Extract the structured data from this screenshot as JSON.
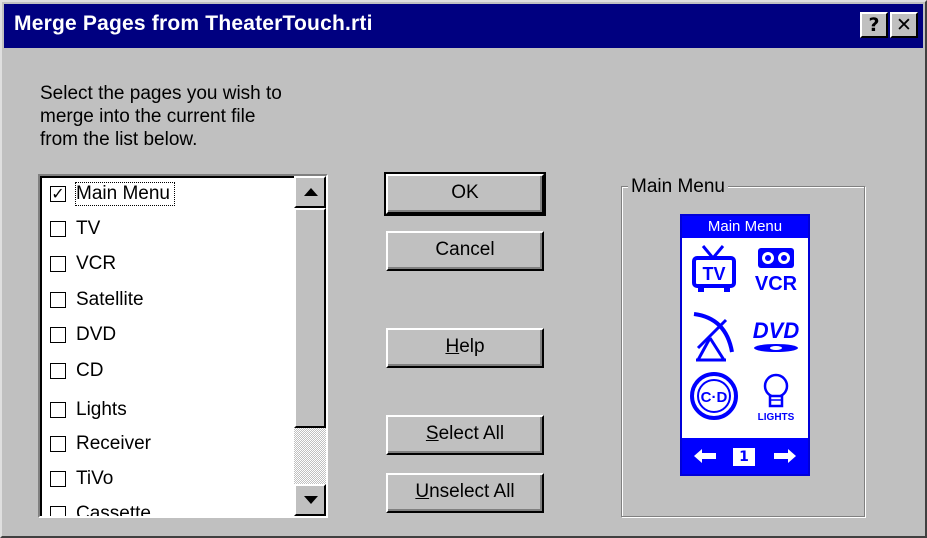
{
  "dialog": {
    "title": "Merge Pages from TheaterTouch.rti",
    "help_glyph": "?",
    "close_glyph": "✕"
  },
  "instructions": {
    "line1": "Select the pages you wish to",
    "line2": "merge into the current file",
    "line3": "from the list below."
  },
  "pages_list": {
    "items": [
      {
        "label": "Main Menu",
        "checked": true
      },
      {
        "label": "TV",
        "checked": false
      },
      {
        "label": "VCR",
        "checked": false
      },
      {
        "label": "Satellite",
        "checked": false
      },
      {
        "label": "DVD",
        "checked": false
      },
      {
        "label": "CD",
        "checked": false
      },
      {
        "label": "Lights",
        "checked": false
      },
      {
        "label": "Receiver",
        "checked": false
      },
      {
        "label": "TiVo",
        "checked": false
      },
      {
        "label": "Cassette",
        "checked": false
      }
    ],
    "check_glyph": "✓"
  },
  "buttons": {
    "ok": "OK",
    "cancel": "Cancel",
    "help_underlined": "H",
    "help_rest": "elp",
    "select_all_underlined": "S",
    "select_all_rest": "elect All",
    "unselect_all_underlined": "U",
    "unselect_all_rest": "nselect All"
  },
  "preview": {
    "group_label": "Main Menu",
    "page_title": "Main Menu",
    "tv_label": "TV",
    "vcr_label": "VCR",
    "dvd_label": "DVD",
    "cd_label": "C·D",
    "lights_label": "LIGHTS",
    "page_number": "1",
    "left_arrow": "←",
    "right_arrow": "→",
    "accent_color": "#0000ff"
  }
}
